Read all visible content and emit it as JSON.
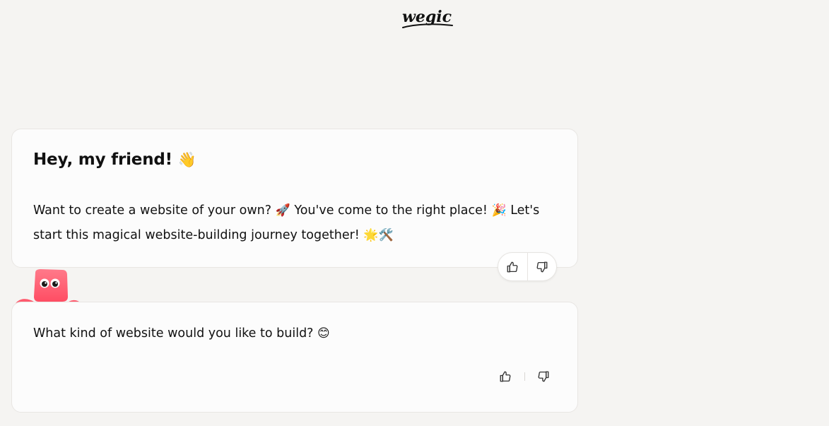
{
  "brand": {
    "logo_text": "wegic"
  },
  "messages": [
    {
      "greeting": "Hey, my friend!",
      "greeting_emoji": "👋",
      "line1_a": "Want to create a website of your own? ",
      "emoji_rocket": "🚀",
      "line1_b": " You've come to the right place! ",
      "emoji_party": "🎉",
      "line1_c": " Let's start this magical website-building journey together! ",
      "emoji_sparkle": "🌟",
      "emoji_tools": "🛠️"
    },
    {
      "text": "What kind of website would you like to build? ",
      "emoji_smile": "😊"
    }
  ],
  "icons": {
    "like": "thumbs-up-icon",
    "dislike": "thumbs-down-icon"
  },
  "colors": {
    "background": "#f5f4f2",
    "card": "#fcfcfc",
    "mascot": "#ff5a6e"
  }
}
